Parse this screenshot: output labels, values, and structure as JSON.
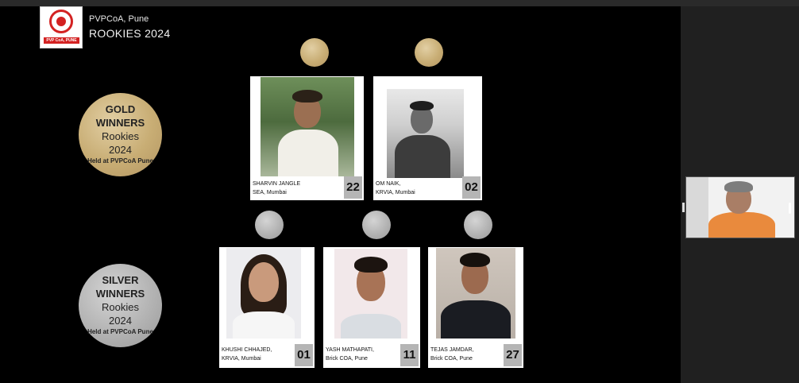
{
  "header": {
    "org_name": "PVPCoA, Pune",
    "event_title": "ROOKIES 2024",
    "logo_text": "PVP CoA, PUNE"
  },
  "gold_badge": {
    "line1": "GOLD",
    "line2": "WINNERS",
    "line3": "Rookies",
    "line4": "2024",
    "held": "Held at PVPCoA Pune",
    "color": "#c8ad74"
  },
  "silver_badge": {
    "line1": "SILVER",
    "line2": "WINNERS",
    "line3": "Rookies",
    "line4": "2024",
    "held": "Held at PVPCoA Pune",
    "color": "#b3b3b3"
  },
  "gold_winners": [
    {
      "name": "SHARVIN JANGLE",
      "college": "SEA, Mumbai",
      "number": "22"
    },
    {
      "name": "OM NAIK,",
      "college": "KRVIA, Mumbai",
      "number": "02"
    }
  ],
  "silver_winners": [
    {
      "name": "KHUSHI CHHAJED,",
      "college": "KRVIA, Mumbai",
      "number": "01"
    },
    {
      "name": "YASH MATHAPATI,",
      "college": "Brick COA, Pune",
      "number": "11"
    },
    {
      "name": "TEJAS JAMDAR,",
      "college": "Brick COA, Pune",
      "number": "27"
    }
  ]
}
